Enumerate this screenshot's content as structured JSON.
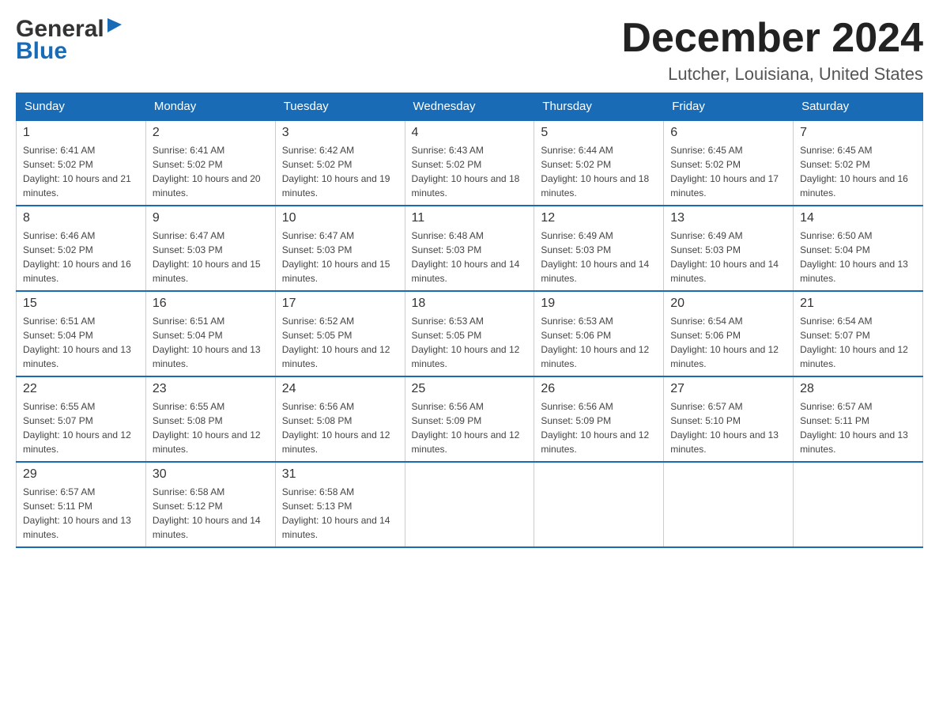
{
  "header": {
    "month_title": "December 2024",
    "location": "Lutcher, Louisiana, United States",
    "logo_general": "General",
    "logo_blue": "Blue"
  },
  "weekdays": [
    "Sunday",
    "Monday",
    "Tuesday",
    "Wednesday",
    "Thursday",
    "Friday",
    "Saturday"
  ],
  "weeks": [
    [
      {
        "day": "1",
        "sunrise": "6:41 AM",
        "sunset": "5:02 PM",
        "daylight": "10 hours and 21 minutes."
      },
      {
        "day": "2",
        "sunrise": "6:41 AM",
        "sunset": "5:02 PM",
        "daylight": "10 hours and 20 minutes."
      },
      {
        "day": "3",
        "sunrise": "6:42 AM",
        "sunset": "5:02 PM",
        "daylight": "10 hours and 19 minutes."
      },
      {
        "day": "4",
        "sunrise": "6:43 AM",
        "sunset": "5:02 PM",
        "daylight": "10 hours and 18 minutes."
      },
      {
        "day": "5",
        "sunrise": "6:44 AM",
        "sunset": "5:02 PM",
        "daylight": "10 hours and 18 minutes."
      },
      {
        "day": "6",
        "sunrise": "6:45 AM",
        "sunset": "5:02 PM",
        "daylight": "10 hours and 17 minutes."
      },
      {
        "day": "7",
        "sunrise": "6:45 AM",
        "sunset": "5:02 PM",
        "daylight": "10 hours and 16 minutes."
      }
    ],
    [
      {
        "day": "8",
        "sunrise": "6:46 AM",
        "sunset": "5:02 PM",
        "daylight": "10 hours and 16 minutes."
      },
      {
        "day": "9",
        "sunrise": "6:47 AM",
        "sunset": "5:03 PM",
        "daylight": "10 hours and 15 minutes."
      },
      {
        "day": "10",
        "sunrise": "6:47 AM",
        "sunset": "5:03 PM",
        "daylight": "10 hours and 15 minutes."
      },
      {
        "day": "11",
        "sunrise": "6:48 AM",
        "sunset": "5:03 PM",
        "daylight": "10 hours and 14 minutes."
      },
      {
        "day": "12",
        "sunrise": "6:49 AM",
        "sunset": "5:03 PM",
        "daylight": "10 hours and 14 minutes."
      },
      {
        "day": "13",
        "sunrise": "6:49 AM",
        "sunset": "5:03 PM",
        "daylight": "10 hours and 14 minutes."
      },
      {
        "day": "14",
        "sunrise": "6:50 AM",
        "sunset": "5:04 PM",
        "daylight": "10 hours and 13 minutes."
      }
    ],
    [
      {
        "day": "15",
        "sunrise": "6:51 AM",
        "sunset": "5:04 PM",
        "daylight": "10 hours and 13 minutes."
      },
      {
        "day": "16",
        "sunrise": "6:51 AM",
        "sunset": "5:04 PM",
        "daylight": "10 hours and 13 minutes."
      },
      {
        "day": "17",
        "sunrise": "6:52 AM",
        "sunset": "5:05 PM",
        "daylight": "10 hours and 12 minutes."
      },
      {
        "day": "18",
        "sunrise": "6:53 AM",
        "sunset": "5:05 PM",
        "daylight": "10 hours and 12 minutes."
      },
      {
        "day": "19",
        "sunrise": "6:53 AM",
        "sunset": "5:06 PM",
        "daylight": "10 hours and 12 minutes."
      },
      {
        "day": "20",
        "sunrise": "6:54 AM",
        "sunset": "5:06 PM",
        "daylight": "10 hours and 12 minutes."
      },
      {
        "day": "21",
        "sunrise": "6:54 AM",
        "sunset": "5:07 PM",
        "daylight": "10 hours and 12 minutes."
      }
    ],
    [
      {
        "day": "22",
        "sunrise": "6:55 AM",
        "sunset": "5:07 PM",
        "daylight": "10 hours and 12 minutes."
      },
      {
        "day": "23",
        "sunrise": "6:55 AM",
        "sunset": "5:08 PM",
        "daylight": "10 hours and 12 minutes."
      },
      {
        "day": "24",
        "sunrise": "6:56 AM",
        "sunset": "5:08 PM",
        "daylight": "10 hours and 12 minutes."
      },
      {
        "day": "25",
        "sunrise": "6:56 AM",
        "sunset": "5:09 PM",
        "daylight": "10 hours and 12 minutes."
      },
      {
        "day": "26",
        "sunrise": "6:56 AM",
        "sunset": "5:09 PM",
        "daylight": "10 hours and 12 minutes."
      },
      {
        "day": "27",
        "sunrise": "6:57 AM",
        "sunset": "5:10 PM",
        "daylight": "10 hours and 13 minutes."
      },
      {
        "day": "28",
        "sunrise": "6:57 AM",
        "sunset": "5:11 PM",
        "daylight": "10 hours and 13 minutes."
      }
    ],
    [
      {
        "day": "29",
        "sunrise": "6:57 AM",
        "sunset": "5:11 PM",
        "daylight": "10 hours and 13 minutes."
      },
      {
        "day": "30",
        "sunrise": "6:58 AM",
        "sunset": "5:12 PM",
        "daylight": "10 hours and 14 minutes."
      },
      {
        "day": "31",
        "sunrise": "6:58 AM",
        "sunset": "5:13 PM",
        "daylight": "10 hours and 14 minutes."
      },
      null,
      null,
      null,
      null
    ]
  ]
}
